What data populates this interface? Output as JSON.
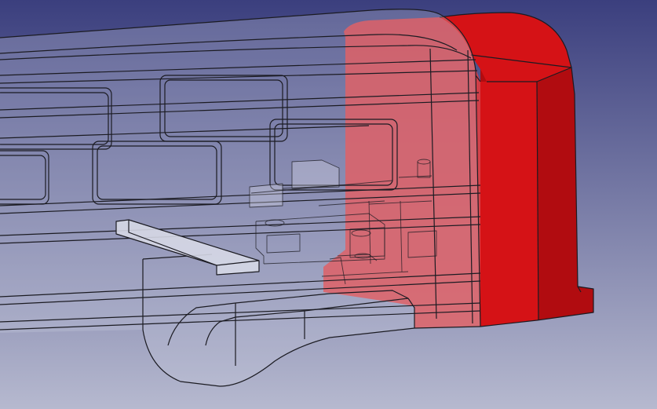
{
  "viewport": {
    "background_top": "#3b3f7e",
    "background_bottom": "#b6b9cf"
  },
  "model": {
    "body_fill": "#c9cbe0",
    "body_fill_opacity": 0.28,
    "edge_color": "#1b1b22",
    "end_cap_color": "#d51216",
    "end_cap_shade": "#b10c10",
    "end_cap_highlight": "#e8383a",
    "inner_part_fill": "#d6d8e6"
  }
}
